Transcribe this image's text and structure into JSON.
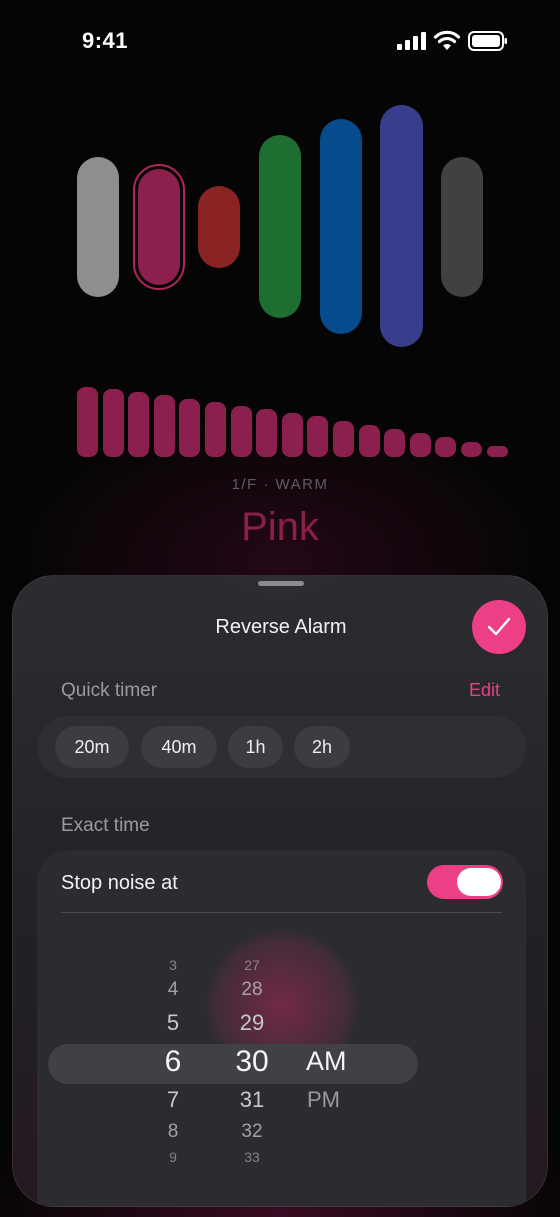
{
  "status_bar": {
    "time": "9:41"
  },
  "noise": {
    "subtitle": "1/F · WARM",
    "title": "Pink",
    "colors": [
      {
        "name": "white",
        "hex": "#8e8e8e"
      },
      {
        "name": "pink",
        "hex": "#8b1f4d",
        "selected": true
      },
      {
        "name": "brown",
        "hex": "#8a2424"
      },
      {
        "name": "green",
        "hex": "#1e6e32"
      },
      {
        "name": "blue",
        "hex": "#064c8c"
      },
      {
        "name": "violet",
        "hex": "#393e8c"
      },
      {
        "name": "grey",
        "hex": "#414141"
      }
    ],
    "spectrum_color": "#8b1f4d",
    "spectrum_levels": [
      1.0,
      0.97,
      0.93,
      0.88,
      0.83,
      0.78,
      0.73,
      0.68,
      0.63,
      0.58,
      0.52,
      0.46,
      0.4,
      0.34,
      0.28,
      0.22,
      0.15
    ]
  },
  "sheet": {
    "title": "Reverse Alarm",
    "confirm_icon": "checkmark-icon",
    "accent": "#ec3f86",
    "quick_timer": {
      "label": "Quick timer",
      "edit_label": "Edit",
      "options": [
        "20m",
        "40m",
        "1h",
        "2h"
      ]
    },
    "exact_time": {
      "label": "Exact time",
      "stop_label": "Stop noise at",
      "toggle_on": true,
      "picker": {
        "hours": [
          "3",
          "4",
          "5",
          "6",
          "7",
          "8",
          "9"
        ],
        "minutes": [
          "27",
          "28",
          "29",
          "30",
          "31",
          "32",
          "33"
        ],
        "selected_hour": "6",
        "selected_minute": "30",
        "periods": [
          "AM",
          "PM"
        ],
        "selected_period": "AM"
      }
    }
  }
}
